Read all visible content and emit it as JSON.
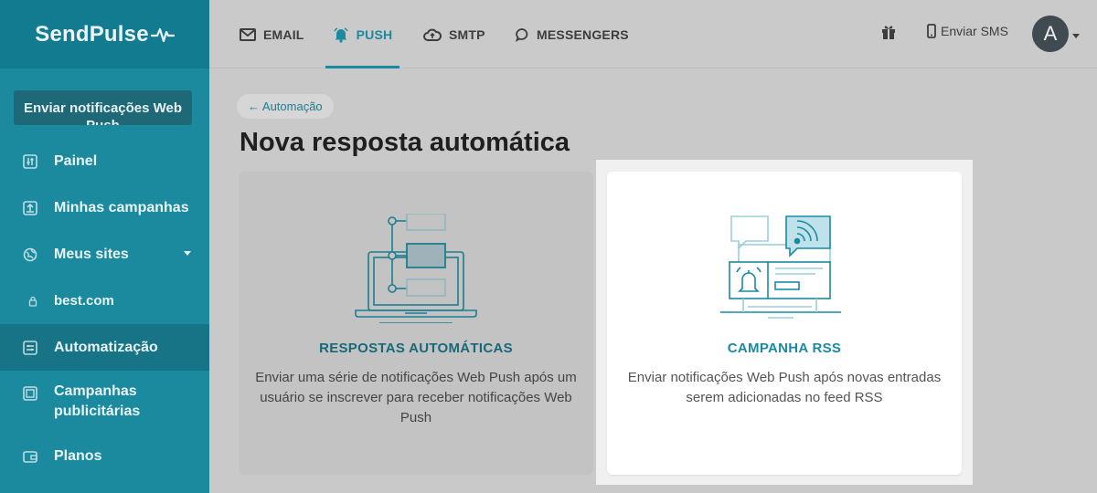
{
  "brand": {
    "logo_text": "SendPulse"
  },
  "sidebar": {
    "cta_label": "Enviar notificações Web Push",
    "items": [
      {
        "label": "Painel",
        "icon": "sliders-icon"
      },
      {
        "label": "Minhas campanhas",
        "icon": "upload-icon"
      },
      {
        "label": "Meus sites",
        "icon": "globe-icon"
      },
      {
        "label": "best.com",
        "icon": "lock-icon"
      },
      {
        "label": "Automatização",
        "icon": "automation-icon"
      },
      {
        "label": "Campanhas publicitárias",
        "icon": "ads-icon"
      },
      {
        "label": "Planos",
        "icon": "wallet-icon"
      }
    ]
  },
  "topnav": {
    "tabs": [
      {
        "label": "EMAIL",
        "icon": "envelope-icon"
      },
      {
        "label": "PUSH",
        "icon": "bell-icon",
        "active": true
      },
      {
        "label": "SMTP",
        "icon": "cloud-icon"
      },
      {
        "label": "MESSENGERS",
        "icon": "chat-icon"
      }
    ],
    "sms_label": "Enviar SMS",
    "avatar_letter": "A"
  },
  "main": {
    "back_label": "← Automação",
    "title": "Nova resposta automática",
    "cards": [
      {
        "title": "RESPOSTAS AUTOMÁTICAS",
        "description": "Enviar uma série de notificações Web Push após um usuário se inscrever para receber notificações Web Push"
      },
      {
        "title": "CAMPANHA RSS",
        "description": "Enviar notificações Web Push após novas entradas serem adicionadas no feed RSS"
      }
    ]
  },
  "colors": {
    "accent": "#1a8aa0",
    "sidebar": "#1b8a9f",
    "sidebar_dark": "#137b8f",
    "overlay_gray": "#c9c9c9"
  }
}
